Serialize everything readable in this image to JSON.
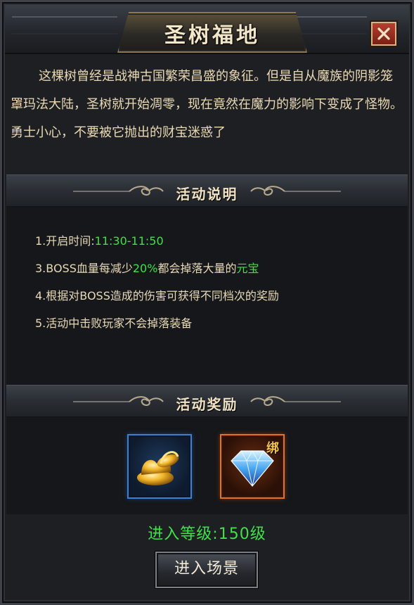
{
  "window": {
    "title": "圣树福地",
    "close_icon": "close-icon"
  },
  "description": "这棵树曾经是战神古国繁荣昌盛的象征。但是自从魔族的阴影笼罩玛法大陆，圣树就开始凋零，现在竟然在魔力的影响下变成了怪物。勇士小心，不要被它抛出的财宝迷惑了",
  "activity_info": {
    "heading": "活动说明",
    "rules": [
      {
        "prefix": "1.开启时间:",
        "highlight": "11:30-11:50",
        "suffix": ""
      },
      {
        "prefix": "3.BOSS血量每减少",
        "highlight": "20%",
        "middle": "都会掉落大量的",
        "highlight2": "元宝"
      },
      {
        "prefix": "4.根据对BOSS造成的伤害可获得不同档次的奖励"
      },
      {
        "prefix": "5.活动中击败玩家不会掉落装备"
      }
    ]
  },
  "rewards": {
    "heading": "活动奖励",
    "items": [
      {
        "icon": "gold-ingot-icon",
        "border_color": "#3d7fd0"
      },
      {
        "icon": "diamond-icon",
        "border_color": "#e0742b",
        "tag": "绑"
      }
    ]
  },
  "enter_level": "进入等级:150级",
  "enter_button": "进入场景",
  "colors": {
    "highlight_green": "#3fe04a",
    "text": "#e8d9b8"
  }
}
